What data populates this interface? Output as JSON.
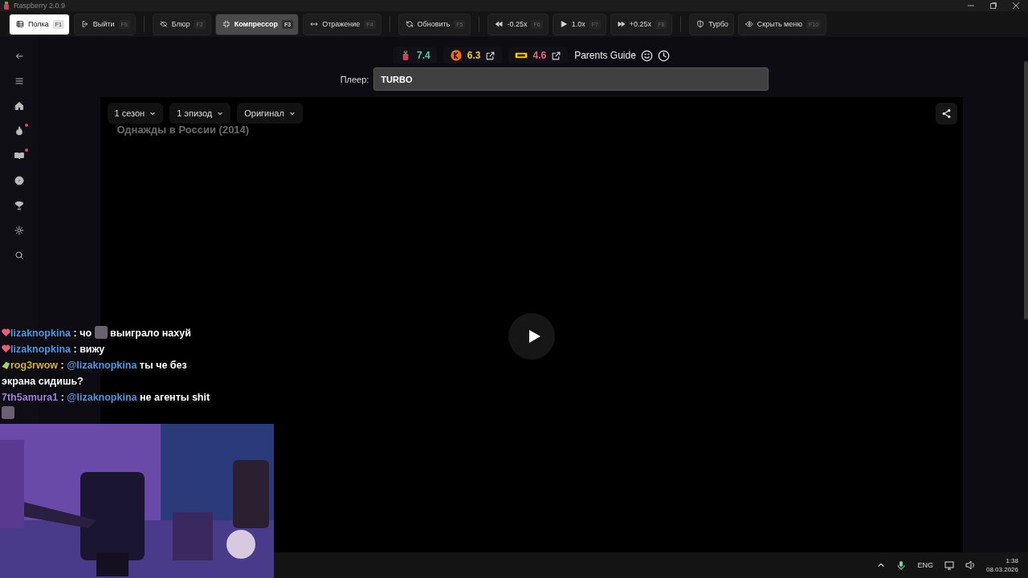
{
  "window": {
    "title": "Raspberry 2.0.9"
  },
  "toolbar": {
    "groups": [
      {
        "buttons": [
          {
            "label": "Полка",
            "key": "F1",
            "selected": true,
            "active": false
          },
          {
            "label": "Выйти",
            "key": "F9",
            "selected": false,
            "active": false
          }
        ]
      },
      {
        "buttons": [
          {
            "label": "Блюр",
            "key": "F2",
            "selected": false,
            "active": false
          },
          {
            "label": "Компрессор",
            "key": "F3",
            "selected": false,
            "active": true
          },
          {
            "label": "Отражение",
            "key": "F4",
            "selected": false,
            "active": false
          }
        ]
      },
      {
        "buttons": [
          {
            "label": "Обновить",
            "key": "F5",
            "selected": false,
            "active": false
          }
        ]
      },
      {
        "buttons": [
          {
            "label": "-0.25x",
            "key": "F6",
            "selected": false,
            "active": false
          },
          {
            "label": "1.0x",
            "key": "F7",
            "selected": false,
            "active": false
          },
          {
            "label": "+0.25x",
            "key": "F8",
            "selected": false,
            "active": false
          }
        ]
      },
      {
        "buttons": [
          {
            "label": "Турбо",
            "selected": false,
            "active": false
          },
          {
            "label": "Скрыть меню",
            "key": "F10",
            "selected": false,
            "active": false
          }
        ]
      }
    ]
  },
  "sidebar": {
    "items": [
      {
        "dot": false
      },
      {
        "dot": false
      },
      {
        "dot": false
      },
      {
        "dot": true
      },
      {
        "dot": true
      },
      {
        "dot": false
      },
      {
        "dot": false
      },
      {
        "dot": false
      },
      {
        "dot": false
      }
    ]
  },
  "ratings": [
    {
      "value": "7.4",
      "color": "#4fd1a5",
      "external": false
    },
    {
      "value": "6.3",
      "color": "#f5c542",
      "external": true
    },
    {
      "value": "4.6",
      "color": "#f0647a",
      "external": true
    }
  ],
  "parents_guide": {
    "label": "Parents Guide"
  },
  "player": {
    "label": "Плеер:",
    "value": "TURBO"
  },
  "video": {
    "title": "Однажды в России (2014)",
    "dropdowns": [
      {
        "label": "1 сезон"
      },
      {
        "label": "1 эпизод"
      },
      {
        "label": "Оригинал"
      }
    ]
  },
  "chat": [
    {
      "user": "lizaknopkina",
      "color": "#4a9be8",
      "kind": "heart",
      "separator": ":",
      "parts": [
        {
          "kind": "text",
          "text": "чо"
        },
        {
          "kind": "emote"
        },
        {
          "kind": "text",
          "text": "выиграло нахуй"
        }
      ]
    },
    {
      "user": "lizaknopkina",
      "color": "#4a9be8",
      "kind": "heart",
      "separator": ":",
      "parts": [
        {
          "kind": "text",
          "text": "вижу"
        }
      ]
    },
    {
      "user": "rog3rwow",
      "color": "#d9b23a",
      "kind": "gem",
      "separator": ":",
      "parts": [
        {
          "kind": "mention",
          "text": "@lizaknopkina"
        },
        {
          "kind": "text",
          "text": "ты че без экрана сидишь?"
        }
      ]
    },
    {
      "user": "7th5amura1",
      "color": "#a97ee6",
      "kind": "plain",
      "separator": ":",
      "parts": [
        {
          "kind": "mention",
          "text": "@lizaknopkina"
        },
        {
          "kind": "text",
          "text": "не агенты shit"
        },
        {
          "kind": "emote"
        }
      ]
    }
  ],
  "taskbar": {
    "language": "ENG",
    "time": "1:38",
    "date": "08.03.2026"
  }
}
